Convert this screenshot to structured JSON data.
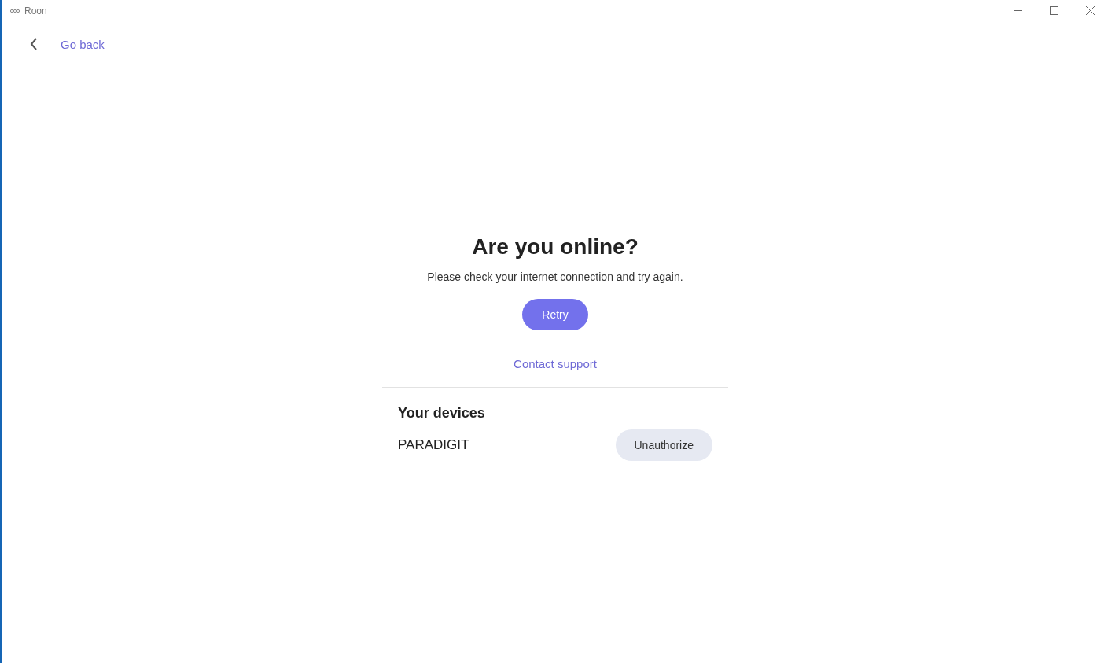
{
  "window": {
    "title": "Roon"
  },
  "nav": {
    "back_label": "Go back"
  },
  "message": {
    "heading": "Are you online?",
    "text": "Please check your internet connection and try again.",
    "retry_button": "Retry",
    "support_link": "Contact support"
  },
  "devices": {
    "title": "Your devices",
    "items": [
      {
        "name": "PARADIGIT",
        "action": "Unauthorize"
      }
    ]
  }
}
